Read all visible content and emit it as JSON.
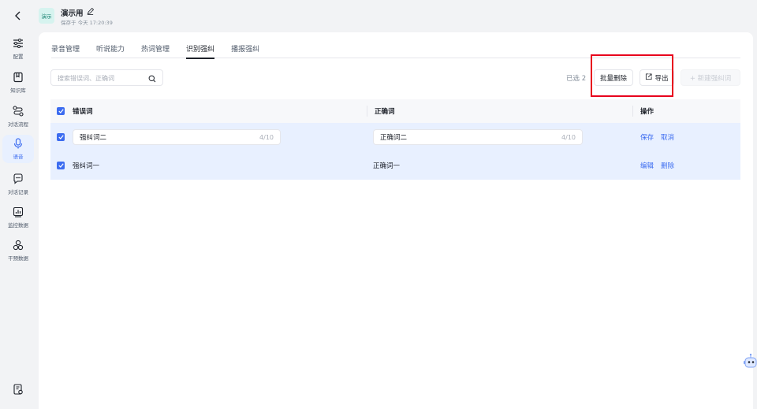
{
  "sidebar": {
    "items": [
      {
        "label": "配置",
        "icon": "sliders-icon"
      },
      {
        "label": "知识库",
        "icon": "book-icon"
      },
      {
        "label": "对话流程",
        "icon": "flow-icon"
      },
      {
        "label": "语音",
        "icon": "microphone-icon",
        "active": true
      },
      {
        "label": "对话记录",
        "icon": "chat-icon"
      },
      {
        "label": "监控数据",
        "icon": "chart-icon"
      },
      {
        "label": "干预数据",
        "icon": "intervene-icon"
      }
    ]
  },
  "header": {
    "badge": "演示",
    "title": "演示用",
    "saved": "保存于 今天 17:20:39"
  },
  "tabs": [
    {
      "label": "录音管理"
    },
    {
      "label": "听说能力"
    },
    {
      "label": "热词管理"
    },
    {
      "label": "识别强纠",
      "active": true
    },
    {
      "label": "播报强纠"
    }
  ],
  "toolbar": {
    "search_placeholder": "搜索错误词、正确词",
    "selected": "已选 2",
    "batch_delete": "批量删除",
    "export": "导出",
    "new": "+ 新建强纠词"
  },
  "table": {
    "headers": {
      "wrong": "错误词",
      "correct": "正确词",
      "ops": "操作"
    },
    "rows": [
      {
        "wrong": "强纠词二",
        "wrong_count": "4/10",
        "correct": "正确词二",
        "correct_count": "4/10",
        "op1": "保存",
        "op2": "取消",
        "editing": true
      },
      {
        "wrong": "强纠词一",
        "correct": "正确词一",
        "op1": "编辑",
        "op2": "删除",
        "editing": false
      }
    ]
  },
  "colors": {
    "accent": "#3c6cf0",
    "row_selected": "#e8f0ff",
    "highlight": "#e8001c"
  }
}
